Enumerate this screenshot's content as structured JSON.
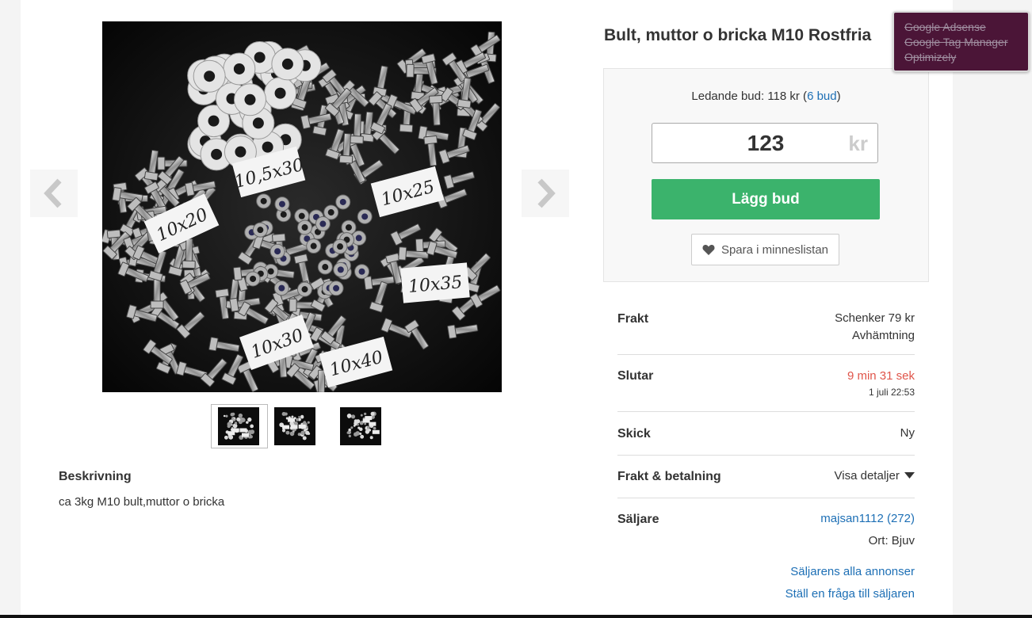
{
  "listing": {
    "title": "Bult, muttor o bricka M10 Rostfria",
    "image_labels": [
      "10x20",
      "10,5x30",
      "10x25",
      "10x35",
      "10x30",
      "10x40"
    ]
  },
  "gallery": {
    "prev_icon": "chevron-left-icon",
    "next_icon": "chevron-right-icon",
    "thumbnail_count": 3,
    "selected_thumbnail": 1
  },
  "description": {
    "heading": "Beskrivning",
    "text": "ca 3kg M10 bult,muttor o bricka"
  },
  "bid": {
    "leading_prefix": "Ledande bud: 118 kr (",
    "bid_count_link": "6 bud",
    "leading_suffix": ")",
    "input_value": "123",
    "input_unit": "kr",
    "button_label": "Lägg bud",
    "save_label": "Spara i minneslistan",
    "save_icon": "heart-icon",
    "accent_color": "#3bb36c"
  },
  "details": {
    "shipping_label": "Frakt",
    "shipping_values": [
      "Schenker 79 kr",
      "Avhämtning"
    ],
    "ends_label": "Slutar",
    "ends_countdown": "9 min 31 sek",
    "ends_date": "1 juli 22:53",
    "condition_label": "Skick",
    "condition_value": "Ny",
    "payment_label": "Frakt & betalning",
    "payment_link": "Visa detaljer",
    "payment_icon": "caret-down-icon",
    "seller_label": "Säljare",
    "seller_name": "majsan1112",
    "seller_rating": "(272)",
    "seller_location": "Ort: Bjuv",
    "seller_all_ads": "Säljarens alla annonser",
    "seller_ask": "Ställ en fråga till säljaren"
  },
  "trackers": [
    "Google Adsense",
    "Google Tag Manager",
    "Optimizely"
  ]
}
